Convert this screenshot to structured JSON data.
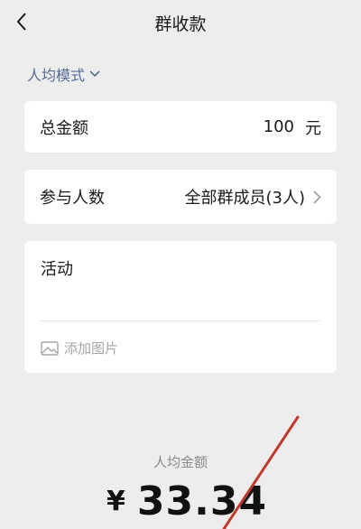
{
  "nav": {
    "title": "群收款",
    "back_icon": "chevron-left-icon"
  },
  "mode": {
    "label": "人均模式",
    "icon": "chevron-down-icon",
    "color": "#576b95"
  },
  "total": {
    "label": "总金额",
    "value": "100",
    "unit": "元"
  },
  "participants": {
    "label": "参与人数",
    "value": "全部群成员(3人)"
  },
  "note": {
    "label": "活动",
    "add_image": "添加图片"
  },
  "average": {
    "label": "人均金额",
    "currency": "¥",
    "value": "33.34"
  },
  "annotation": {
    "color": "#c0392b"
  }
}
